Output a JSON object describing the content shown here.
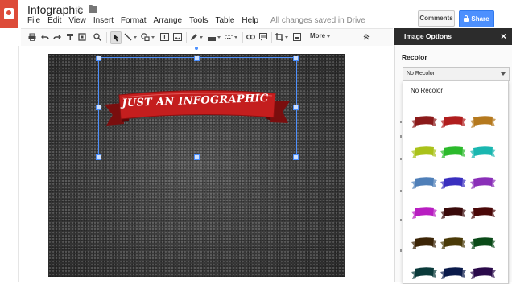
{
  "app": {
    "doc_title": "Infographic",
    "menu": [
      "File",
      "Edit",
      "View",
      "Insert",
      "Format",
      "Arrange",
      "Tools",
      "Table",
      "Help"
    ],
    "save_status": "All changes saved in Drive",
    "comments_label": "Comments",
    "share_label": "Share"
  },
  "toolbar": {
    "more_label": "More"
  },
  "canvas": {
    "banner_text": "JUST AN INFOGRAPHIC",
    "banner_color": "#c41e1e",
    "selection_color": "#4d90fe"
  },
  "panel": {
    "title": "Image Options",
    "section": "Recolor",
    "select_value": "No Recolor",
    "dropdown_first": "No Recolor",
    "swatches": [
      {
        "name": "dark-red",
        "color": "#8b1a1a"
      },
      {
        "name": "red",
        "color": "#b01e1e"
      },
      {
        "name": "orange-brown",
        "color": "#b5791e"
      },
      {
        "name": "yellow-green",
        "color": "#aac21a"
      },
      {
        "name": "green",
        "color": "#2cba2c"
      },
      {
        "name": "teal",
        "color": "#1ab7b0"
      },
      {
        "name": "steel-blue",
        "color": "#4f7fb8"
      },
      {
        "name": "blue",
        "color": "#3a2fbf"
      },
      {
        "name": "purple",
        "color": "#8a2fb8"
      },
      {
        "name": "magenta",
        "color": "#b81ec1"
      },
      {
        "name": "dark-maroon",
        "color": "#3a0a0a"
      },
      {
        "name": "dark-red-2",
        "color": "#4a0808"
      },
      {
        "name": "dark-brown",
        "color": "#3c2507"
      },
      {
        "name": "olive-brown",
        "color": "#4a3a08"
      },
      {
        "name": "dark-green",
        "color": "#0a4a18"
      },
      {
        "name": "dark-teal",
        "color": "#0a3a3a"
      },
      {
        "name": "navy",
        "color": "#0a1a4a"
      },
      {
        "name": "dark-purple",
        "color": "#2a0a4a"
      }
    ]
  }
}
